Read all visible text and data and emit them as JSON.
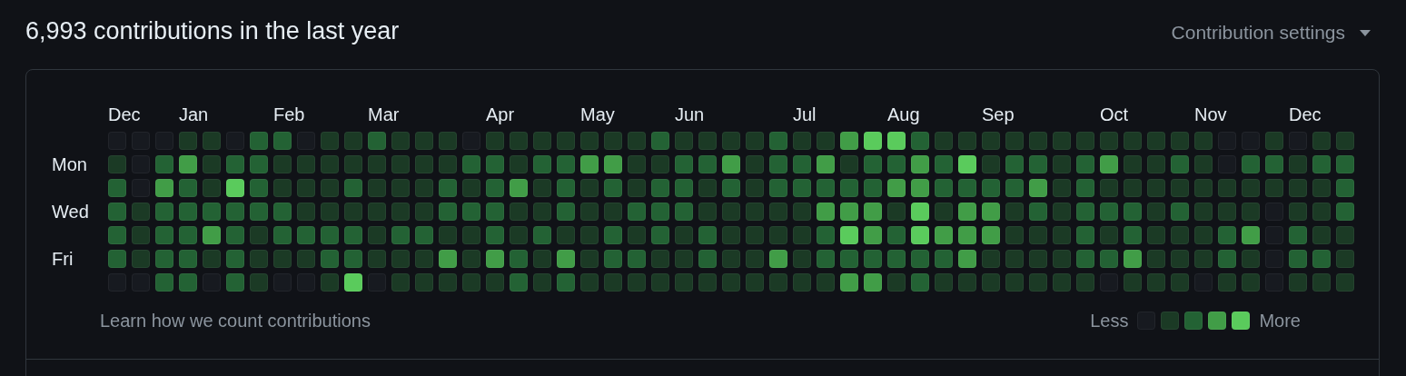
{
  "heading": "6,993 contributions in the last year",
  "settings": {
    "label": "Contribution settings"
  },
  "columns": [
    {
      "month": "Dec"
    },
    {},
    {},
    {
      "month": "Jan"
    },
    {},
    {},
    {},
    {
      "month": "Feb"
    },
    {},
    {},
    {},
    {
      "month": "Mar"
    },
    {},
    {},
    {},
    {},
    {
      "month": "Apr"
    },
    {},
    {},
    {},
    {
      "month": "May"
    },
    {},
    {},
    {},
    {
      "month": "Jun"
    },
    {},
    {},
    {},
    {},
    {
      "month": "Jul"
    },
    {},
    {},
    {},
    {
      "month": "Aug"
    },
    {},
    {},
    {},
    {
      "month": "Sep"
    },
    {},
    {},
    {},
    {},
    {
      "month": "Oct"
    },
    {},
    {},
    {},
    {
      "month": "Nov"
    },
    {},
    {},
    {},
    {
      "month": "Dec"
    },
    {},
    {}
  ],
  "rows": [
    {
      "cells": [
        {
          "color": "#171a20"
        },
        {
          "color": "#171a20"
        },
        {
          "color": "#171a20"
        },
        {
          "color": "#1b3a25"
        },
        {
          "color": "#1b3a25"
        },
        {
          "color": "#171a20"
        },
        {
          "color": "#236234"
        },
        {
          "color": "#236234"
        },
        {
          "color": "#171a20"
        },
        {
          "color": "#1b3a25"
        },
        {
          "color": "#1b3a25"
        },
        {
          "color": "#236234"
        },
        {
          "color": "#1b3a25"
        },
        {
          "color": "#1b3a25"
        },
        {
          "color": "#1b3a25"
        },
        {
          "color": "#171a20"
        },
        {
          "color": "#1b3a25"
        },
        {
          "color": "#1b3a25"
        },
        {
          "color": "#1b3a25"
        },
        {
          "color": "#1b3a25"
        },
        {
          "color": "#1b3a25"
        },
        {
          "color": "#1b3a25"
        },
        {
          "color": "#1b3a25"
        },
        {
          "color": "#236234"
        },
        {
          "color": "#1b3a25"
        },
        {
          "color": "#1b3a25"
        },
        {
          "color": "#1b3a25"
        },
        {
          "color": "#1b3a25"
        },
        {
          "color": "#236234"
        },
        {
          "color": "#1b3a25"
        },
        {
          "color": "#1b3a25"
        },
        {
          "color": "#419d47"
        },
        {
          "color": "#5acb5c"
        },
        {
          "color": "#5acb5c"
        },
        {
          "color": "#236234"
        },
        {
          "color": "#1b3a25"
        },
        {
          "color": "#1b3a25"
        },
        {
          "color": "#1b3a25"
        },
        {
          "color": "#1b3a25"
        },
        {
          "color": "#1b3a25"
        },
        {
          "color": "#1b3a25"
        },
        {
          "color": "#1b3a25"
        },
        {
          "color": "#1b3a25"
        },
        {
          "color": "#1b3a25"
        },
        {
          "color": "#1b3a25"
        },
        {
          "color": "#1b3a25"
        },
        {
          "color": "#1b3a25"
        },
        {
          "color": "#171a20"
        },
        {
          "color": "#171a20"
        },
        {
          "color": "#1b3a25"
        },
        {
          "color": "#171a20"
        },
        {
          "color": "#1b3a25"
        },
        {
          "color": "#1b3a25"
        }
      ]
    },
    {
      "label": "Mon",
      "cells": [
        {
          "color": "#1b3a25"
        },
        {
          "color": "#171a20"
        },
        {
          "color": "#236234"
        },
        {
          "color": "#419d47"
        },
        {
          "color": "#1b3a25"
        },
        {
          "color": "#236234"
        },
        {
          "color": "#236234"
        },
        {
          "color": "#1b3a25"
        },
        {
          "color": "#1b3a25"
        },
        {
          "color": "#1b3a25"
        },
        {
          "color": "#1b3a25"
        },
        {
          "color": "#1b3a25"
        },
        {
          "color": "#1b3a25"
        },
        {
          "color": "#1b3a25"
        },
        {
          "color": "#1b3a25"
        },
        {
          "color": "#236234"
        },
        {
          "color": "#236234"
        },
        {
          "color": "#1b3a25"
        },
        {
          "color": "#236234"
        },
        {
          "color": "#236234"
        },
        {
          "color": "#419d47"
        },
        {
          "color": "#419d47"
        },
        {
          "color": "#1b3a25"
        },
        {
          "color": "#1b3a25"
        },
        {
          "color": "#236234"
        },
        {
          "color": "#236234"
        },
        {
          "color": "#419d47"
        },
        {
          "color": "#1b3a25"
        },
        {
          "color": "#236234"
        },
        {
          "color": "#236234"
        },
        {
          "color": "#419d47"
        },
        {
          "color": "#1b3a25"
        },
        {
          "color": "#236234"
        },
        {
          "color": "#236234"
        },
        {
          "color": "#419d47"
        },
        {
          "color": "#236234"
        },
        {
          "color": "#5acb5c"
        },
        {
          "color": "#1b3a25"
        },
        {
          "color": "#236234"
        },
        {
          "color": "#236234"
        },
        {
          "color": "#1b3a25"
        },
        {
          "color": "#236234"
        },
        {
          "color": "#419d47"
        },
        {
          "color": "#1b3a25"
        },
        {
          "color": "#1b3a25"
        },
        {
          "color": "#236234"
        },
        {
          "color": "#1b3a25"
        },
        {
          "color": "#171a20"
        },
        {
          "color": "#236234"
        },
        {
          "color": "#236234"
        },
        {
          "color": "#1b3a25"
        },
        {
          "color": "#236234"
        },
        {
          "color": "#236234"
        }
      ]
    },
    {
      "cells": [
        {
          "color": "#236234"
        },
        {
          "color": "#171a20"
        },
        {
          "color": "#419d47"
        },
        {
          "color": "#236234"
        },
        {
          "color": "#1b3a25"
        },
        {
          "color": "#5acb5c"
        },
        {
          "color": "#236234"
        },
        {
          "color": "#1b3a25"
        },
        {
          "color": "#1b3a25"
        },
        {
          "color": "#1b3a25"
        },
        {
          "color": "#236234"
        },
        {
          "color": "#1b3a25"
        },
        {
          "color": "#1b3a25"
        },
        {
          "color": "#1b3a25"
        },
        {
          "color": "#236234"
        },
        {
          "color": "#1b3a25"
        },
        {
          "color": "#236234"
        },
        {
          "color": "#419d47"
        },
        {
          "color": "#1b3a25"
        },
        {
          "color": "#236234"
        },
        {
          "color": "#1b3a25"
        },
        {
          "color": "#236234"
        },
        {
          "color": "#1b3a25"
        },
        {
          "color": "#236234"
        },
        {
          "color": "#236234"
        },
        {
          "color": "#1b3a25"
        },
        {
          "color": "#236234"
        },
        {
          "color": "#1b3a25"
        },
        {
          "color": "#236234"
        },
        {
          "color": "#236234"
        },
        {
          "color": "#236234"
        },
        {
          "color": "#236234"
        },
        {
          "color": "#236234"
        },
        {
          "color": "#419d47"
        },
        {
          "color": "#419d47"
        },
        {
          "color": "#236234"
        },
        {
          "color": "#236234"
        },
        {
          "color": "#236234"
        },
        {
          "color": "#236234"
        },
        {
          "color": "#419d47"
        },
        {
          "color": "#1b3a25"
        },
        {
          "color": "#236234"
        },
        {
          "color": "#1b3a25"
        },
        {
          "color": "#1b3a25"
        },
        {
          "color": "#1b3a25"
        },
        {
          "color": "#1b3a25"
        },
        {
          "color": "#1b3a25"
        },
        {
          "color": "#1b3a25"
        },
        {
          "color": "#1b3a25"
        },
        {
          "color": "#1b3a25"
        },
        {
          "color": "#1b3a25"
        },
        {
          "color": "#1b3a25"
        },
        {
          "color": "#236234"
        }
      ]
    },
    {
      "label": "Wed",
      "cells": [
        {
          "color": "#236234"
        },
        {
          "color": "#1b3a25"
        },
        {
          "color": "#236234"
        },
        {
          "color": "#236234"
        },
        {
          "color": "#236234"
        },
        {
          "color": "#236234"
        },
        {
          "color": "#236234"
        },
        {
          "color": "#236234"
        },
        {
          "color": "#1b3a25"
        },
        {
          "color": "#1b3a25"
        },
        {
          "color": "#1b3a25"
        },
        {
          "color": "#1b3a25"
        },
        {
          "color": "#1b3a25"
        },
        {
          "color": "#1b3a25"
        },
        {
          "color": "#236234"
        },
        {
          "color": "#236234"
        },
        {
          "color": "#236234"
        },
        {
          "color": "#1b3a25"
        },
        {
          "color": "#1b3a25"
        },
        {
          "color": "#236234"
        },
        {
          "color": "#1b3a25"
        },
        {
          "color": "#1b3a25"
        },
        {
          "color": "#236234"
        },
        {
          "color": "#236234"
        },
        {
          "color": "#236234"
        },
        {
          "color": "#1b3a25"
        },
        {
          "color": "#1b3a25"
        },
        {
          "color": "#1b3a25"
        },
        {
          "color": "#1b3a25"
        },
        {
          "color": "#1b3a25"
        },
        {
          "color": "#419d47"
        },
        {
          "color": "#419d47"
        },
        {
          "color": "#419d47"
        },
        {
          "color": "#1b3a25"
        },
        {
          "color": "#5acb5c"
        },
        {
          "color": "#1b3a25"
        },
        {
          "color": "#419d47"
        },
        {
          "color": "#419d47"
        },
        {
          "color": "#1b3a25"
        },
        {
          "color": "#236234"
        },
        {
          "color": "#1b3a25"
        },
        {
          "color": "#236234"
        },
        {
          "color": "#236234"
        },
        {
          "color": "#236234"
        },
        {
          "color": "#1b3a25"
        },
        {
          "color": "#236234"
        },
        {
          "color": "#1b3a25"
        },
        {
          "color": "#1b3a25"
        },
        {
          "color": "#1b3a25"
        },
        {
          "color": "#171a20"
        },
        {
          "color": "#1b3a25"
        },
        {
          "color": "#1b3a25"
        },
        {
          "color": "#236234"
        }
      ]
    },
    {
      "cells": [
        {
          "color": "#236234"
        },
        {
          "color": "#1b3a25"
        },
        {
          "color": "#236234"
        },
        {
          "color": "#236234"
        },
        {
          "color": "#419d47"
        },
        {
          "color": "#236234"
        },
        {
          "color": "#1b3a25"
        },
        {
          "color": "#236234"
        },
        {
          "color": "#236234"
        },
        {
          "color": "#236234"
        },
        {
          "color": "#236234"
        },
        {
          "color": "#1b3a25"
        },
        {
          "color": "#236234"
        },
        {
          "color": "#236234"
        },
        {
          "color": "#1b3a25"
        },
        {
          "color": "#1b3a25"
        },
        {
          "color": "#236234"
        },
        {
          "color": "#1b3a25"
        },
        {
          "color": "#236234"
        },
        {
          "color": "#1b3a25"
        },
        {
          "color": "#1b3a25"
        },
        {
          "color": "#236234"
        },
        {
          "color": "#1b3a25"
        },
        {
          "color": "#236234"
        },
        {
          "color": "#1b3a25"
        },
        {
          "color": "#236234"
        },
        {
          "color": "#1b3a25"
        },
        {
          "color": "#1b3a25"
        },
        {
          "color": "#1b3a25"
        },
        {
          "color": "#1b3a25"
        },
        {
          "color": "#236234"
        },
        {
          "color": "#5acb5c"
        },
        {
          "color": "#419d47"
        },
        {
          "color": "#236234"
        },
        {
          "color": "#5acb5c"
        },
        {
          "color": "#419d47"
        },
        {
          "color": "#419d47"
        },
        {
          "color": "#419d47"
        },
        {
          "color": "#1b3a25"
        },
        {
          "color": "#1b3a25"
        },
        {
          "color": "#1b3a25"
        },
        {
          "color": "#236234"
        },
        {
          "color": "#1b3a25"
        },
        {
          "color": "#236234"
        },
        {
          "color": "#1b3a25"
        },
        {
          "color": "#1b3a25"
        },
        {
          "color": "#1b3a25"
        },
        {
          "color": "#236234"
        },
        {
          "color": "#419d47"
        },
        {
          "color": "#171a20"
        },
        {
          "color": "#236234"
        },
        {
          "color": "#1b3a25"
        },
        {
          "color": "#1b3a25"
        }
      ]
    },
    {
      "label": "Fri",
      "cells": [
        {
          "color": "#236234"
        },
        {
          "color": "#1b3a25"
        },
        {
          "color": "#236234"
        },
        {
          "color": "#236234"
        },
        {
          "color": "#1b3a25"
        },
        {
          "color": "#236234"
        },
        {
          "color": "#1b3a25"
        },
        {
          "color": "#1b3a25"
        },
        {
          "color": "#1b3a25"
        },
        {
          "color": "#236234"
        },
        {
          "color": "#236234"
        },
        {
          "color": "#1b3a25"
        },
        {
          "color": "#1b3a25"
        },
        {
          "color": "#1b3a25"
        },
        {
          "color": "#419d47"
        },
        {
          "color": "#1b3a25"
        },
        {
          "color": "#419d47"
        },
        {
          "color": "#236234"
        },
        {
          "color": "#1b3a25"
        },
        {
          "color": "#419d47"
        },
        {
          "color": "#1b3a25"
        },
        {
          "color": "#236234"
        },
        {
          "color": "#236234"
        },
        {
          "color": "#1b3a25"
        },
        {
          "color": "#1b3a25"
        },
        {
          "color": "#236234"
        },
        {
          "color": "#1b3a25"
        },
        {
          "color": "#1b3a25"
        },
        {
          "color": "#419d47"
        },
        {
          "color": "#1b3a25"
        },
        {
          "color": "#236234"
        },
        {
          "color": "#236234"
        },
        {
          "color": "#236234"
        },
        {
          "color": "#236234"
        },
        {
          "color": "#236234"
        },
        {
          "color": "#236234"
        },
        {
          "color": "#419d47"
        },
        {
          "color": "#1b3a25"
        },
        {
          "color": "#1b3a25"
        },
        {
          "color": "#1b3a25"
        },
        {
          "color": "#1b3a25"
        },
        {
          "color": "#236234"
        },
        {
          "color": "#236234"
        },
        {
          "color": "#419d47"
        },
        {
          "color": "#1b3a25"
        },
        {
          "color": "#1b3a25"
        },
        {
          "color": "#1b3a25"
        },
        {
          "color": "#236234"
        },
        {
          "color": "#1b3a25"
        },
        {
          "color": "#171a20"
        },
        {
          "color": "#236234"
        },
        {
          "color": "#236234"
        },
        {
          "color": "#1b3a25"
        }
      ]
    },
    {
      "cells": [
        {
          "color": "#171a20"
        },
        {
          "color": "#171a20"
        },
        {
          "color": "#236234"
        },
        {
          "color": "#236234"
        },
        {
          "color": "#171a20"
        },
        {
          "color": "#236234"
        },
        {
          "color": "#1b3a25"
        },
        {
          "color": "#171a20"
        },
        {
          "color": "#171a20"
        },
        {
          "color": "#1b3a25"
        },
        {
          "color": "#5acb5c"
        },
        {
          "color": "#171a20"
        },
        {
          "color": "#1b3a25"
        },
        {
          "color": "#1b3a25"
        },
        {
          "color": "#1b3a25"
        },
        {
          "color": "#1b3a25"
        },
        {
          "color": "#1b3a25"
        },
        {
          "color": "#236234"
        },
        {
          "color": "#1b3a25"
        },
        {
          "color": "#236234"
        },
        {
          "color": "#1b3a25"
        },
        {
          "color": "#1b3a25"
        },
        {
          "color": "#1b3a25"
        },
        {
          "color": "#1b3a25"
        },
        {
          "color": "#1b3a25"
        },
        {
          "color": "#1b3a25"
        },
        {
          "color": "#1b3a25"
        },
        {
          "color": "#1b3a25"
        },
        {
          "color": "#1b3a25"
        },
        {
          "color": "#1b3a25"
        },
        {
          "color": "#1b3a25"
        },
        {
          "color": "#419d47"
        },
        {
          "color": "#419d47"
        },
        {
          "color": "#1b3a25"
        },
        {
          "color": "#236234"
        },
        {
          "color": "#1b3a25"
        },
        {
          "color": "#1b3a25"
        },
        {
          "color": "#1b3a25"
        },
        {
          "color": "#1b3a25"
        },
        {
          "color": "#1b3a25"
        },
        {
          "color": "#1b3a25"
        },
        {
          "color": "#1b3a25"
        },
        {
          "color": "#171a20"
        },
        {
          "color": "#1b3a25"
        },
        {
          "color": "#1b3a25"
        },
        {
          "color": "#1b3a25"
        },
        {
          "color": "#171a20"
        },
        {
          "color": "#1b3a25"
        },
        {
          "color": "#1b3a25"
        },
        {
          "color": "#171a20"
        },
        {
          "color": "#1b3a25"
        },
        {
          "color": "#1b3a25"
        },
        {
          "color": "#1b3a25"
        }
      ]
    }
  ],
  "footer": {
    "link": "Learn how we count contributions",
    "less": "Less",
    "more": "More",
    "legend": [
      {
        "color": "#171a20"
      },
      {
        "color": "#1b3a25"
      },
      {
        "color": "#236234"
      },
      {
        "color": "#419d47"
      },
      {
        "color": "#5acb5c"
      }
    ]
  }
}
